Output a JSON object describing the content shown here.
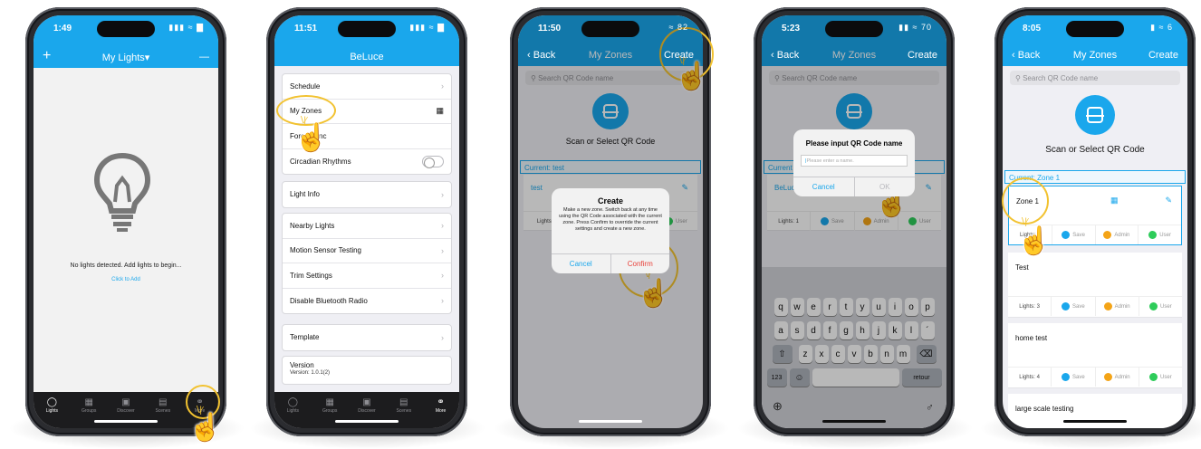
{
  "phones": {
    "lights": {
      "time": "1:49",
      "status": "▮▮▮ ≈ ▇",
      "add": "+",
      "title": "My Lights▾",
      "minus": "—",
      "empty_message": "No lights detected. Add lights to begin...",
      "click_to_add": "Click to Add",
      "tabs": [
        "Lights",
        "Groups",
        "Discover",
        "Scenes",
        "More"
      ]
    },
    "more": {
      "time": "11:51",
      "status": "▮▮▮ ≈ ▇",
      "title": "BeLuce",
      "group1": [
        "Schedule",
        "My Zones",
        "Force Sync",
        "Circadian Rhythms"
      ],
      "group2": [
        "Light Info"
      ],
      "group3": [
        "Nearby Lights",
        "Motion Sensor Testing",
        "Trim Settings",
        "Disable Bluetooth Radio"
      ],
      "group4": [
        "Template"
      ],
      "version_label": "Version",
      "version_value": "Version: 1.0.1(2)",
      "tabs": [
        "Lights",
        "Groups",
        "Discover",
        "Scenes",
        "More"
      ]
    },
    "zones_create": {
      "time": "11:50",
      "status": "≈ 82",
      "back": "Back",
      "title": "My Zones",
      "create": "Create",
      "search_placeholder": "Search QR Code name",
      "scan_text": "Scan or Select QR Code",
      "current": "Current: test",
      "zone_name": "test",
      "lights": "Lights:",
      "user": "User",
      "dialog_title": "Create",
      "dialog_message": "Make a new zone. Switch back at any time using the QR Code associated with the current zone. Press Confirm to override the current settings and create a new zone.",
      "cancel": "Cancel",
      "confirm": "Confirm"
    },
    "zones_input": {
      "time": "5:23",
      "status": "▮▮ ≈ 70",
      "back": "Back",
      "title": "My Zones",
      "create": "Create",
      "search_placeholder": "Search QR Code name",
      "current": "Current",
      "zone_name": "BeLuce",
      "lights": "Lights: 1",
      "save": "Save",
      "admin": "Admin",
      "user": "User",
      "dialog_title": "Please input QR Code name",
      "input_placeholder": "Please enter a name.",
      "cancel": "Cancel",
      "ok": "OK",
      "keys_row1": [
        "q",
        "w",
        "e",
        "r",
        "t",
        "y",
        "u",
        "i",
        "o",
        "p"
      ],
      "keys_row2": [
        "a",
        "s",
        "d",
        "f",
        "g",
        "h",
        "j",
        "k",
        "l",
        "´"
      ],
      "keys_row3": [
        "z",
        "x",
        "c",
        "v",
        "b",
        "n",
        "m"
      ],
      "shift": "⇧",
      "backspace": "⌫",
      "num_key": "123",
      "emoji": "☺",
      "return_key": "retour",
      "globe": "⊕",
      "mic": "♂"
    },
    "zones_list": {
      "time": "8:05",
      "status": "▮ ≈ 6",
      "back": "Back",
      "title": "My Zones",
      "create": "Create",
      "search_placeholder": "Search QR Code name",
      "scan_text": "Scan or Select QR Code",
      "current": "Current: Zone 1",
      "zones": [
        {
          "name": "Zone 1",
          "lights": "Lights: 1"
        },
        {
          "name": "Test",
          "lights": "Lights: 3"
        },
        {
          "name": "home test",
          "lights": "Lights: 4"
        },
        {
          "name": "large scale testing",
          "lights": ""
        }
      ],
      "save": "Save",
      "admin": "Admin",
      "user": "User"
    }
  },
  "colors": {
    "accent": "#1aa7ec",
    "highlight": "#f2c230",
    "confirm": "#e8413a"
  },
  "icons": [
    "lightbulb-icon",
    "hand-pointer-icon",
    "qr-scan-icon",
    "qr-code-icon",
    "edit-icon",
    "share-icon"
  ]
}
